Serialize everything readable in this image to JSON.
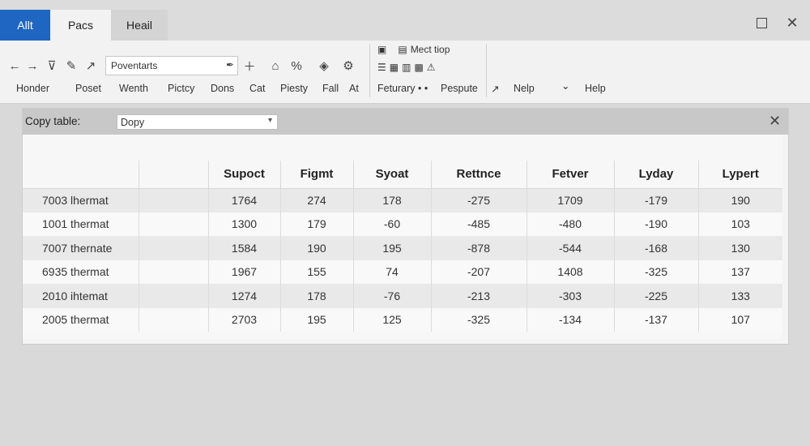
{
  "tabs": [
    {
      "label": "Allt",
      "active": true
    },
    {
      "label": "Pacs"
    },
    {
      "label": "Heail"
    }
  ],
  "window": {
    "maximize_icon": "maximize-icon",
    "close_icon": "close-icon"
  },
  "toolbar": {
    "search_value": "Poventarts",
    "search_icon": "pen-icon",
    "right_group": {
      "top_label": "Mect tiop"
    },
    "menu": [
      "Honder",
      "Poset",
      "Wenth",
      "Pictcy",
      "Dons",
      "Cat",
      "Piesty",
      "Fall",
      "At"
    ],
    "menu_right": [
      "Feturary • •",
      "Pespute",
      "↗",
      "Nelp",
      "⌄",
      "Help"
    ]
  },
  "panel": {
    "copy_label": "Copy table:",
    "copy_value": "Dopy",
    "close_icon": "close-icon"
  },
  "table": {
    "headers": [
      "",
      "",
      "Supoct",
      "Figmt",
      "Syoat",
      "Rettnce",
      "Fetver",
      "Lyday",
      "Lypert"
    ],
    "rows": [
      [
        "7003 lhermat",
        "",
        "1764",
        "274",
        "178",
        "-275",
        "1709",
        "-179",
        "190"
      ],
      [
        "1001 thermat",
        "",
        "1300",
        "179",
        "-60",
        "-485",
        "-480",
        "-190",
        "103"
      ],
      [
        "7007 thernate",
        "",
        "1584",
        "190",
        "195",
        "-878",
        "-544",
        "-168",
        "130"
      ],
      [
        "6935 thermat",
        "",
        "1967",
        "155",
        "74",
        "-207",
        "1408",
        "-325",
        "137"
      ],
      [
        "2010 ihtemat",
        "",
        "1274",
        "178",
        "-76",
        "-213",
        "-303",
        "-225",
        "133"
      ],
      [
        "2005 thermat",
        "",
        "2703",
        "195",
        "125",
        "-325",
        "-134",
        "-137",
        "107"
      ]
    ]
  },
  "colors": {
    "accent": "#1f66c2"
  }
}
